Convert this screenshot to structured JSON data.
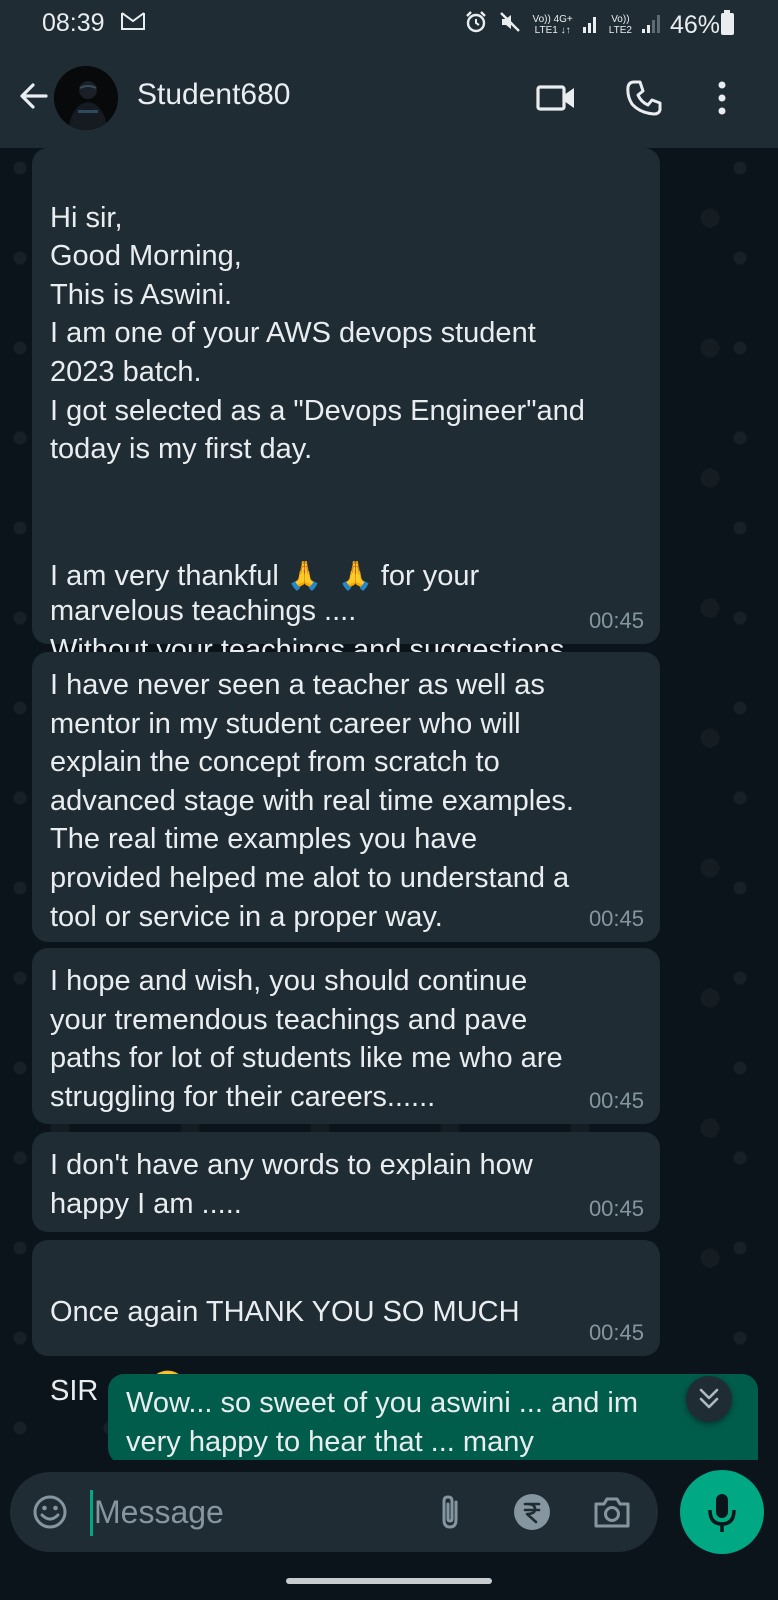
{
  "status_bar": {
    "time": "08:39",
    "mail_icon": "M",
    "network1": "Vo)) 4G+\nLTE1 ↓↑",
    "network2": "Vo))\nLTE2",
    "battery": "46%"
  },
  "header": {
    "contact_name": "Student680",
    "icons": [
      "back-arrow-icon",
      "video-call-icon",
      "voice-call-icon",
      "more-options-icon"
    ]
  },
  "messages": [
    {
      "lines_before": "Hi sir,\nGood Morning,\nThis is Aswini.\nI am one of your AWS devops student\n2023 batch.\nI got selected as a \"Devops Engineer\"and\ntoday is my first day.",
      "line_emoji_a": "I am very thankful ",
      "emoji1": "🙏",
      "emoji2": "🙏",
      "line_emoji_b": " for your",
      "lines_after": "marvelous teachings ....\nWithout your teachings and suggestions,\nI might not able to crack interviews.",
      "time": "00:45"
    },
    {
      "text": "I have never seen a teacher as well as\nmentor in my student career who will\nexplain the concept from scratch to\nadvanced stage with real time examples.\nThe real time examples you have\nprovided helped me alot to understand a\ntool or service in a proper way.",
      "time": "00:45"
    },
    {
      "text": "I hope and wish, you should continue\nyour tremendous teachings and pave\npaths for lot of students like me who are\nstruggling for their careers......",
      "time": "00:45"
    },
    {
      "text": "I don't have any words to explain how\nhappy I am .....",
      "time": "00:45"
    },
    {
      "text_a": "Once again THANK YOU SO MUCH",
      "text_b": "SIR .....",
      "emoji": "🤗",
      "time": "00:45"
    }
  ],
  "outgoing": {
    "line1": "Wow... so sweet of you aswini ... and im",
    "line2": "very happy to hear that ... many"
  },
  "composer": {
    "placeholder": "Message"
  },
  "colors": {
    "background": "#0b141a",
    "bar": "#1f2c34",
    "incoming_bubble": "#1f2c34",
    "outgoing_bubble": "#005c4b",
    "accent": "#00a884",
    "timestamp": "#8696a0"
  }
}
